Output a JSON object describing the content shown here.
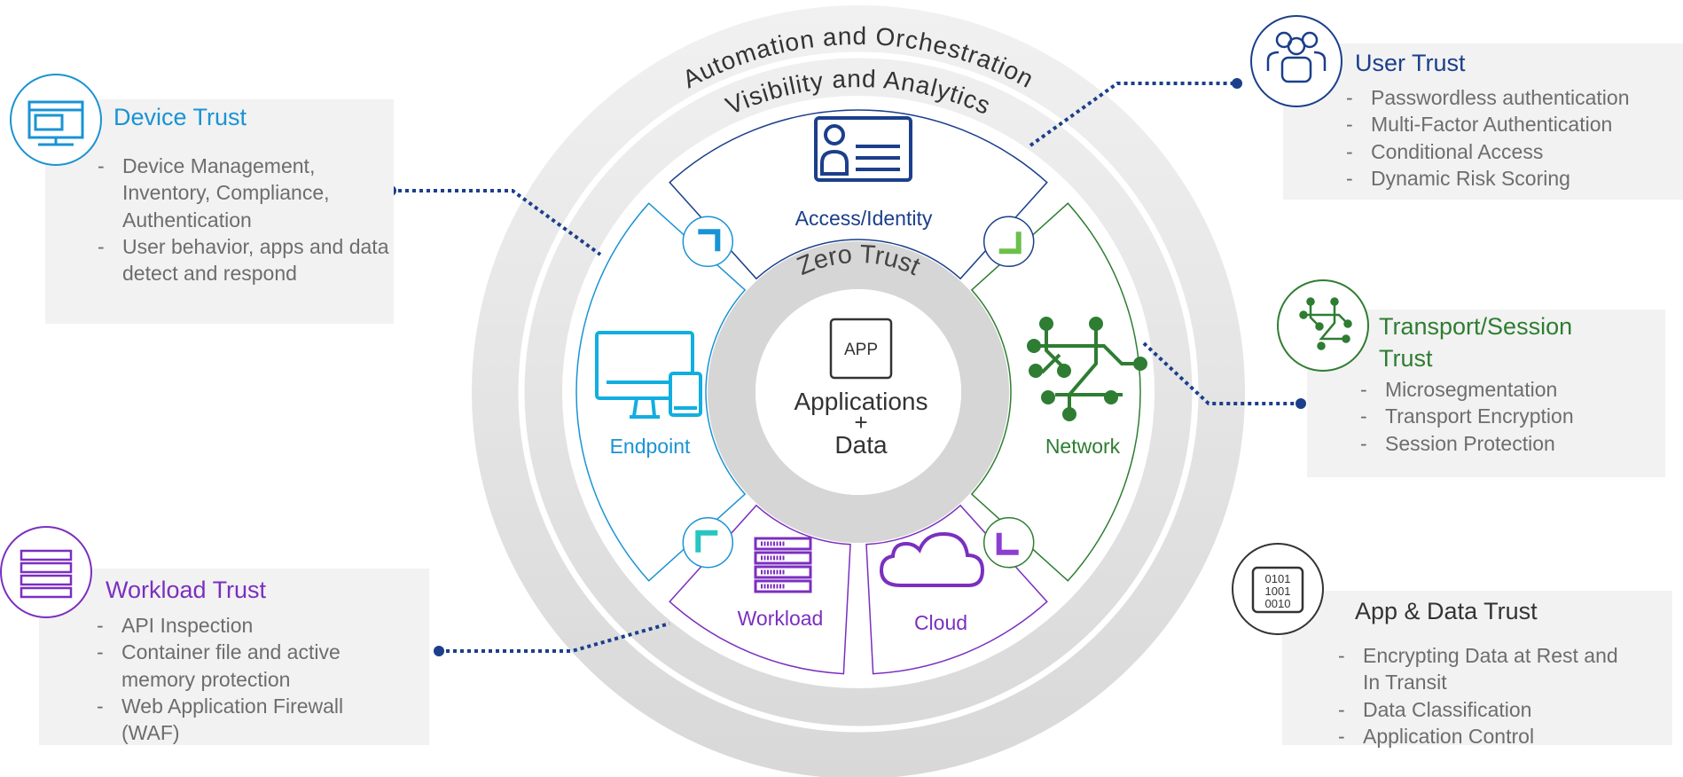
{
  "rings": {
    "outer": "Automation and Orchestration",
    "middle": "Visibility and Analytics",
    "core_ring": "Zero Trust"
  },
  "core": {
    "icon_label": "APP",
    "line1": "Applications",
    "line2": "+",
    "line3": "Data"
  },
  "segments": {
    "access": "Access/Identity",
    "endpoint": "Endpoint",
    "network": "Network",
    "workload": "Workload",
    "cloud": "Cloud"
  },
  "panels": {
    "device": {
      "title": "Device Trust",
      "items": [
        "Device Management, Inventory, Compliance, Authentication",
        "User behavior, apps and data detect and respond"
      ],
      "icon": "monitor-browser-icon"
    },
    "user": {
      "title": "User Trust",
      "items": [
        "Passwordless authentication",
        "Multi-Factor Authentication",
        "Conditional Access",
        "Dynamic Risk Scoring"
      ],
      "icon": "users-group-icon"
    },
    "transport": {
      "title_line1": "Transport/Session",
      "title_line2": "Trust",
      "items": [
        "Microsegmentation",
        "Transport Encryption",
        "Session Protection"
      ],
      "icon": "network-nodes-icon"
    },
    "workload": {
      "title": "Workload Trust",
      "items": [
        "API Inspection",
        "Container file and active memory protection",
        "Web Application Firewall (WAF)"
      ],
      "icon": "server-rack-icon"
    },
    "appdata": {
      "title": "App & Data Trust",
      "items": [
        "Encrypting Data at Rest and In Transit",
        "Data Classification",
        "Application Control"
      ],
      "icon": "binary-document-icon",
      "binary": [
        "0101",
        "1001",
        "0010"
      ]
    }
  },
  "colors": {
    "device": "#1a93d4",
    "user": "#1b3f8b",
    "transport": "#2e7d32",
    "workload": "#7b2fbf",
    "appdata": "#333333",
    "body_text": "#6d6d6d",
    "panel_bg": "#f2f2f2",
    "connector": "#1b3f8b"
  }
}
